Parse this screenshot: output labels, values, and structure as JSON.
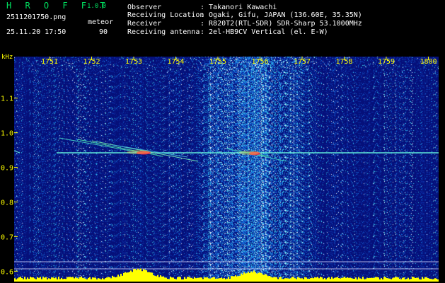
{
  "header": {
    "app_name": "H R O F F T",
    "version": "1.0.0",
    "filename": "2511201750.png",
    "datetime": "25.11.20 17:50",
    "mode": "meteor",
    "count": "90"
  },
  "station": [
    {
      "label": "Observer",
      "value": ": Takanori Kawachi"
    },
    {
      "label": "Receiving Location",
      "value": ": Ogaki, Gifu, JAPAN (136.60E, 35.35N)"
    },
    {
      "label": "Receiver",
      "value": ": R820T2(RTL-SDR) SDR-Sharp 53.1000MHz"
    },
    {
      "label": "Receiving antenna",
      "value": ": 2el-HB9CV Vertical (el. E-W)"
    }
  ],
  "axis": {
    "unit": "kHz",
    "x_ticks": [
      "1751",
      "1752",
      "1753",
      "1754",
      "1755",
      "1756",
      "1757",
      "1758",
      "1759",
      "1800"
    ],
    "y_ticks": [
      "1.1",
      "1.0",
      "0.9",
      "0.8",
      "0.7",
      "0.6"
    ],
    "y_values": [
      1.1,
      1.0,
      0.9,
      0.8,
      0.7,
      0.6
    ],
    "y_range": [
      0.57,
      1.22
    ]
  },
  "colors": {
    "text_primary": "#ffff00",
    "text_white": "#ffffff",
    "logo": "#00e060",
    "background": "#000000",
    "spectrum_bg": "#05107a",
    "carrier": "#5fe8d8",
    "meteor_hot": "#ff2040",
    "meteor_warm": "#ffd040",
    "level_bar": "#ffff00"
  }
}
